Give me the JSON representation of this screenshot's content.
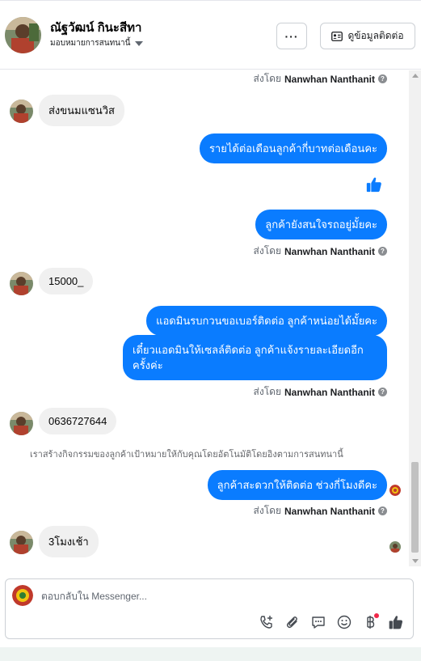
{
  "header": {
    "contact_name": "ณัฐวัฒน์ กินะสีทา",
    "assign_label": "มอบหมายการสนทนานี้",
    "more_label": "···",
    "view_contact_label": "ดูข้อมูลติดต่อ"
  },
  "thread": {
    "sent_by_prefix": "ส่งโดย",
    "sent_by_name": "Nanwhan Nanthanit",
    "messages": [
      {
        "dir": "in",
        "text": "ส่งขนมแซนวิส"
      },
      {
        "dir": "out",
        "text": "รายได้ต่อเดือนลูกค้ากี่บาทต่อเดือนคะ"
      },
      {
        "dir": "out",
        "text": "ลูกค้ายังสนใจรถอยู่มั้ยคะ"
      },
      {
        "dir": "in",
        "text": "15000_"
      },
      {
        "dir": "out",
        "text": "แอดมินรบกวนขอเบอร์ติดต่อ ลูกค้าหน่อยได้มั้ยคะ"
      },
      {
        "dir": "out",
        "text": "เดี๋ยวแอดมินให้เซลล์ติดต่อ ลูกค้าแจ้งรายละเอียดอีกครั้งค่ะ"
      },
      {
        "dir": "in",
        "text": "0636727644"
      },
      {
        "dir": "out",
        "text": "ลูกค้าสะดวกให้ติดต่อ ช่วงกี่โมงดีคะ"
      },
      {
        "dir": "in",
        "text": "3โมงเช้า"
      }
    ],
    "system_note": "เราสร้างกิจกรรมของลูกค้าเป้าหมายให้กับคุณโดยอัตโนมัติโดยอิงตามการสนทนานี้"
  },
  "composer": {
    "placeholder": "ตอบกลับใน Messenger...",
    "tools": [
      "phone-add-icon",
      "attach-icon",
      "saved-reply-icon",
      "emoji-icon",
      "baht-icon",
      "like-icon"
    ]
  },
  "colors": {
    "brand_blue": "#0a7cff",
    "incoming_bg": "#f0f0f0",
    "notification_dot": "#f02849"
  }
}
